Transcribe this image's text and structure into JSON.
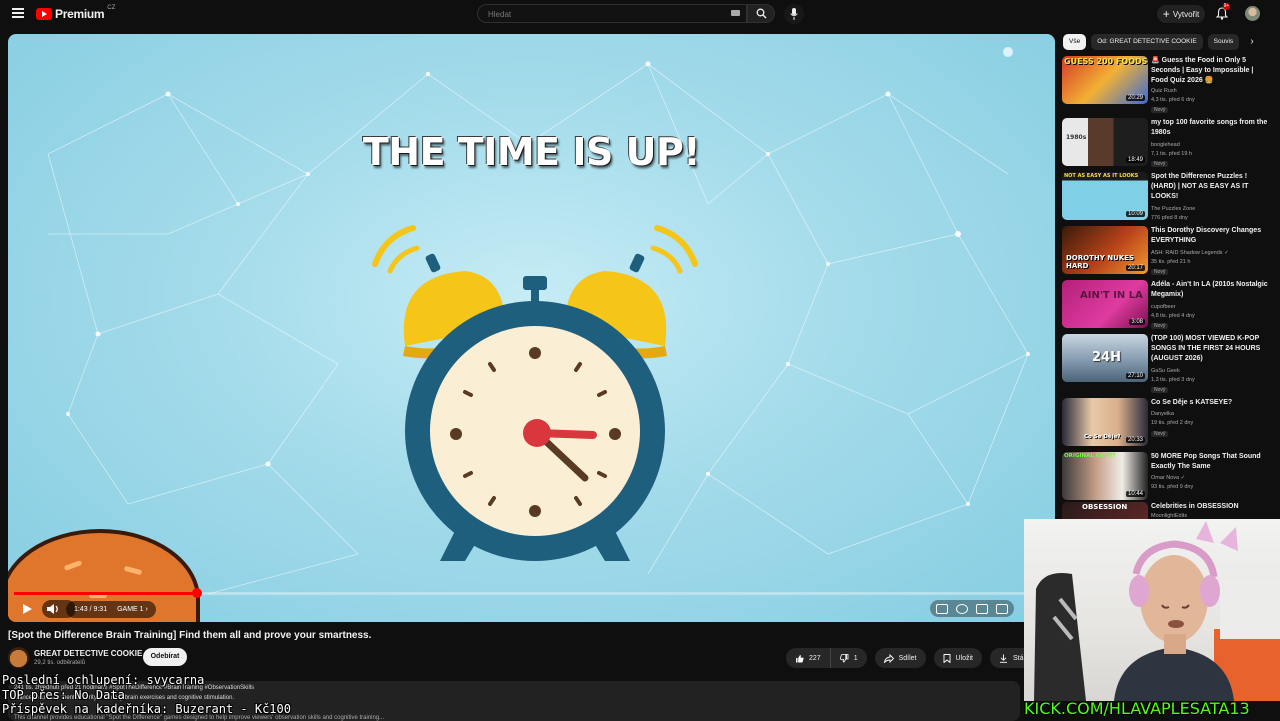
{
  "topbar": {
    "logo_text": "Premium",
    "country_code": "CZ",
    "search_placeholder": "Hledat",
    "create_label": "Vytvořit",
    "notification_count": "9+",
    "icons": [
      "menu-icon",
      "youtube-logo-icon",
      "keyboard-icon",
      "search-icon",
      "mic-icon",
      "plus-icon",
      "bell-icon"
    ]
  },
  "player": {
    "overlay_title": "THE TIME IS UP!",
    "current_time": "1:43",
    "duration": "9:31",
    "time_display": "1:43 / 9:31",
    "chapter": "GAME 1",
    "progress": 0.181,
    "accent_color": "#ff0000"
  },
  "video": {
    "title": "[Spot the Difference Brain Training] Find them all and prove your smartness.",
    "channel": "GREAT DETECTIVE COOKIE",
    "subscribers": "29,2 tis. odběratelů",
    "subscribe_label": "Odebírat",
    "likes": "227",
    "dislikes": "1",
    "share_label": "Sdílet",
    "save_label": "Uložit",
    "download_label": "Stáhnout"
  },
  "description": {
    "line1": "241 tis. zhlédnutí  před 21 hodinami  #SpotTheDifference #BrainTraining #ObservationSkills",
    "line2": "...ance focus and mental clarity with daily brain exercises and cognitive stimulation.",
    "line3": "This channel provides educational \"Spot the Difference\" games designed to help improve viewers' observation skills and cognitive training..."
  },
  "overlay": {
    "line1": "Poslední ochlupení: svycarna",
    "line2": "TOP přes: No Data",
    "line3": "Příspěvek na kadeřníka: Buzerant - Kč100",
    "kick_url": "KICK.COM/HLAVAPLESATA13"
  },
  "sidebar": {
    "chips": [
      "Vše",
      "Od: GREAT DETECTIVE COOKIE",
      "Souvis"
    ],
    "items": [
      {
        "title": "🚨 Guess the Food in Only 5 Seconds | Easy to Impossible | Food Quiz 2026 🍔",
        "channel": "Quiz Rush",
        "meta": "4,3 tis.  před 6 dny",
        "badge": "Nový",
        "duration": "20:29",
        "thumb_text": "GUESS 200 FOODS"
      },
      {
        "title": "my top 100 favorite songs from the 1980s",
        "channel": "booglehead",
        "meta": "7,1 tis.  před 19 h",
        "badge": "Nový",
        "duration": "18:49",
        "thumb_text": "1980s"
      },
      {
        "title": "Spot the Difference Puzzles ! (HARD) | NOT AS EASY AS IT LOOKS!",
        "channel": "The Puzzles Zone",
        "meta": "776  před 8 dny",
        "badge": "",
        "duration": "10:09",
        "thumb_text": "NOT AS EASY AS IT LOOKS"
      },
      {
        "title": "This Dorothy Discovery Changes EVERYTHING",
        "channel": "ASH: RAID Shadow Legends ✓",
        "meta": "35 tis.  před 21 h",
        "badge": "Nový",
        "duration": "20:17",
        "thumb_text": "DOROTHY NUKES HARD"
      },
      {
        "title": "Adéla - Ain't In LA (2010s Nostalgic Megamix)",
        "channel": "cupofbeer",
        "meta": "4,8 tis.  před 4 dny",
        "badge": "Nový",
        "duration": "3:08",
        "thumb_text": "AIN'T IN LA"
      },
      {
        "title": "(TOP 100) MOST VIEWED K-POP SONGS IN THE FIRST 24 HOURS (AUGUST 2026)",
        "channel": "GaSu Geek",
        "meta": "1,3 tis.  před 3 dny",
        "badge": "Nový",
        "duration": "27:10",
        "thumb_text": "24H"
      },
      {
        "title": "Co Se Děje s KATSEYE?",
        "channel": "Danyelka",
        "meta": "19 tis.  před 2 dny",
        "badge": "Nový",
        "duration": "20:33",
        "thumb_text": "Co Se Děje?"
      },
      {
        "title": "50 MORE Pop Songs That Sound Exactly The Same",
        "channel": "Omar Nova ✓",
        "meta": "93 tis.  před 9 dny",
        "badge": "",
        "duration": "10:44",
        "thumb_text": "ORIGINAL COPY?"
      },
      {
        "title": "Celebrities in OBSESSION",
        "channel": "MoonlightEdits",
        "meta": "",
        "badge": "",
        "duration": "",
        "thumb_text": "OBSESSION"
      }
    ]
  }
}
